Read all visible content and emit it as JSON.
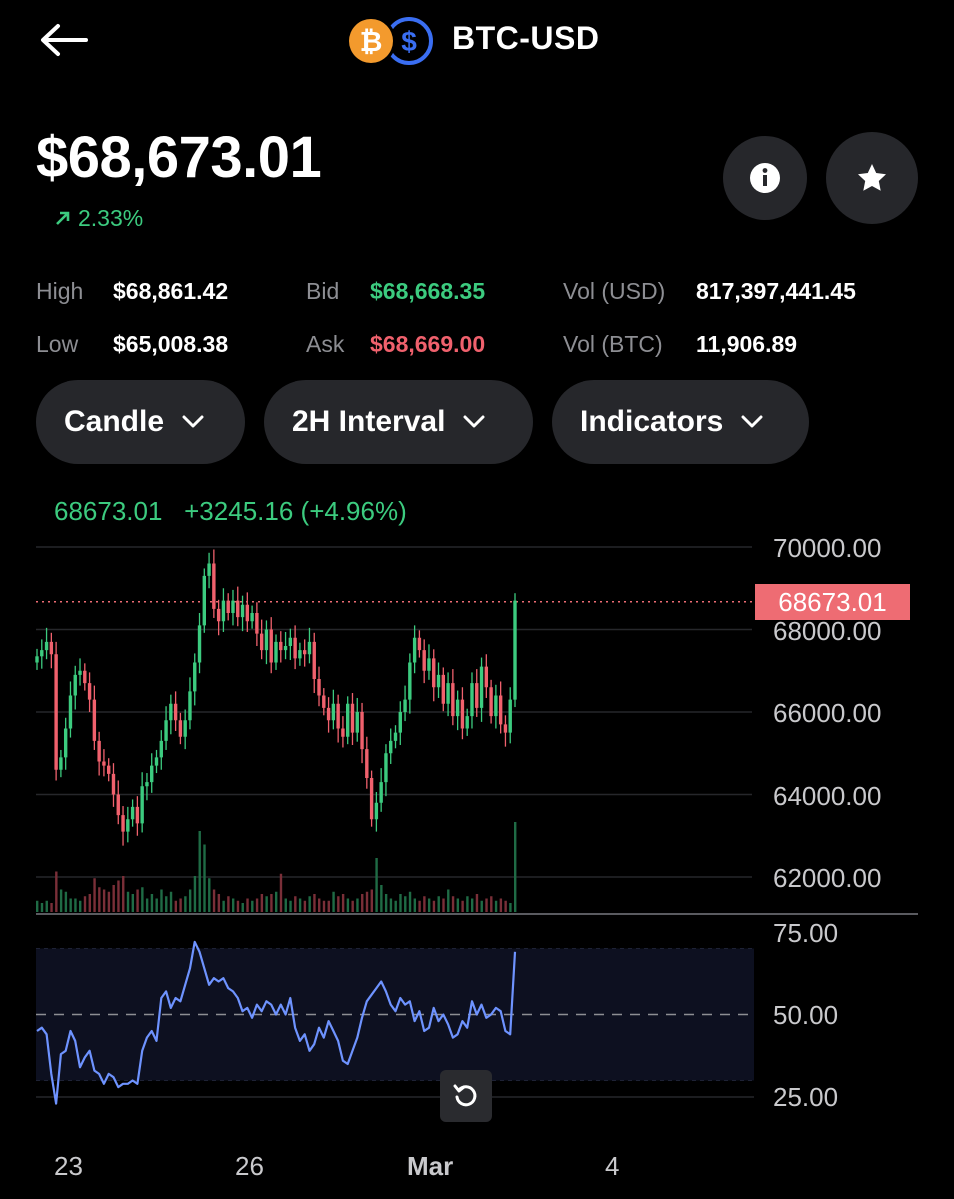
{
  "header": {
    "pair": "BTC-USD",
    "icons": {
      "back": "arrow-left-icon",
      "base": "bitcoin-icon",
      "quote": "dollar-icon"
    }
  },
  "summary": {
    "price": "$68,673.01",
    "change": "2.33%",
    "change_color": "#3ccb7f"
  },
  "actions": {
    "info_icon": "info-icon",
    "star_icon": "star-icon"
  },
  "stats": {
    "high_label": "High",
    "high_value": "$68,861.42",
    "low_label": "Low",
    "low_value": "$65,008.38",
    "bid_label": "Bid",
    "bid_value": "$68,668.35",
    "ask_label": "Ask",
    "ask_value": "$68,669.00",
    "vol_usd_label": "Vol (USD)",
    "vol_usd_value": "817,397,441.45",
    "vol_btc_label": "Vol (BTC)",
    "vol_btc_value": "11,906.89"
  },
  "controls": {
    "chart_type": "Candle",
    "interval": "2H Interval",
    "indicators": "Indicators"
  },
  "chart_data": [
    {
      "type": "candlestick",
      "header": {
        "last": "68673.01",
        "change": "+3245.16",
        "change_pct": "(+4.96%)"
      },
      "y_ticks": [
        "70000.00",
        "68000.00",
        "66000.00",
        "64000.00",
        "62000.00"
      ],
      "ylim": [
        61000,
        70000
      ],
      "current_price_label": "68673.01",
      "current_price": 68673.01,
      "x_labels": [
        "23",
        "26",
        "Mar",
        "4"
      ],
      "colors": {
        "up": "#3ccb7f",
        "down": "#f0616d",
        "price_line": "#ee6c73"
      },
      "close": [
        67350,
        67500,
        67700,
        67400,
        64600,
        64900,
        65600,
        66400,
        66900,
        67000,
        66700,
        66300,
        65300,
        64800,
        64700,
        64500,
        64000,
        63500,
        63100,
        63400,
        63700,
        63300,
        64200,
        64300,
        64700,
        64900,
        65300,
        65800,
        66200,
        65800,
        65400,
        65800,
        66500,
        67200,
        68100,
        69300,
        69600,
        68500,
        68200,
        68700,
        68400,
        68700,
        68300,
        68600,
        68200,
        68400,
        67900,
        67500,
        68000,
        67200,
        67700,
        67500,
        67600,
        67800,
        67300,
        67500,
        67400,
        67700,
        66800,
        66400,
        66100,
        65800,
        66200,
        65600,
        65400,
        66200,
        65500,
        66000,
        65100,
        64400,
        63400,
        63800,
        64300,
        65000,
        65300,
        65500,
        66000,
        66300,
        67200,
        67800,
        67500,
        67000,
        67300,
        66600,
        66900,
        66200,
        66700,
        65900,
        66300,
        65600,
        65900,
        66700,
        66100,
        67100,
        66600,
        65900,
        66400,
        65700,
        65500,
        66300,
        68700
      ],
      "volume": [
        0.05,
        0.04,
        0.05,
        0.04,
        0.18,
        0.1,
        0.09,
        0.06,
        0.06,
        0.05,
        0.07,
        0.08,
        0.15,
        0.11,
        0.1,
        0.09,
        0.12,
        0.14,
        0.16,
        0.09,
        0.08,
        0.1,
        0.11,
        0.06,
        0.08,
        0.06,
        0.1,
        0.07,
        0.09,
        0.05,
        0.06,
        0.07,
        0.1,
        0.16,
        0.36,
        0.3,
        0.15,
        0.1,
        0.08,
        0.05,
        0.07,
        0.06,
        0.05,
        0.04,
        0.06,
        0.05,
        0.06,
        0.08,
        0.07,
        0.08,
        0.09,
        0.17,
        0.06,
        0.05,
        0.07,
        0.06,
        0.05,
        0.07,
        0.08,
        0.06,
        0.05,
        0.05,
        0.09,
        0.07,
        0.08,
        0.06,
        0.05,
        0.06,
        0.08,
        0.09,
        0.1,
        0.24,
        0.12,
        0.08,
        0.06,
        0.05,
        0.08,
        0.07,
        0.09,
        0.06,
        0.05,
        0.07,
        0.06,
        0.05,
        0.07,
        0.06,
        0.1,
        0.07,
        0.06,
        0.05,
        0.07,
        0.06,
        0.08,
        0.05,
        0.06,
        0.07,
        0.05,
        0.06,
        0.05,
        0.04,
        0.4
      ]
    },
    {
      "type": "line",
      "y_ticks": [
        "75.00",
        "50.00",
        "25.00"
      ],
      "ylim": [
        25,
        75
      ],
      "band": [
        30,
        70
      ],
      "midline": 50,
      "line_color": "#6e93ff",
      "values": [
        45,
        46,
        44,
        32,
        23,
        38,
        39,
        45,
        42,
        34,
        37,
        39,
        33,
        32,
        29,
        32,
        31,
        28,
        29,
        29,
        30,
        29,
        39,
        43,
        45,
        42,
        55,
        57,
        52,
        55,
        54,
        59,
        64,
        72,
        69,
        64,
        59,
        61,
        60,
        61,
        58,
        57,
        55,
        51,
        52,
        49,
        53,
        51,
        54,
        53,
        50,
        53,
        50,
        55,
        46,
        42,
        44,
        39,
        41,
        46,
        43,
        48,
        45,
        42,
        36,
        35,
        39,
        43,
        49,
        54,
        56,
        58,
        60,
        57,
        53,
        51,
        55,
        53,
        54,
        48,
        51,
        45,
        46,
        52,
        48,
        50,
        47,
        43,
        44,
        48,
        46,
        54,
        50,
        53,
        49,
        50,
        52,
        51,
        45,
        44,
        69
      ]
    }
  ],
  "reset_icon": "rotate-ccw-icon"
}
